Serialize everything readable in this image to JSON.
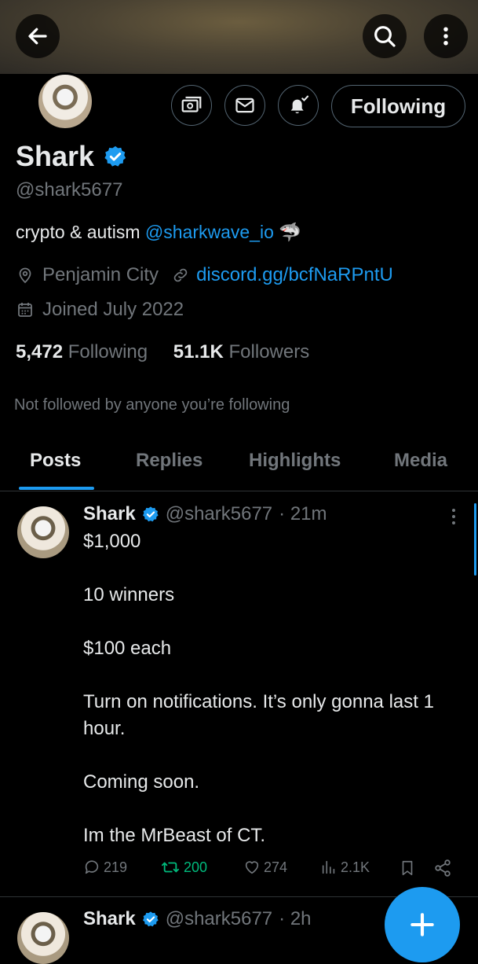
{
  "header": {
    "back_icon": "arrow-left-icon",
    "search_icon": "search-icon",
    "more_icon": "more-vertical-icon"
  },
  "profile": {
    "name": "Shark",
    "handle": "@shark5677",
    "bio_text": "crypto & autism ",
    "bio_mention": "@sharkwave_io",
    "bio_emoji": "🦈",
    "location": "Penjamin City",
    "website": "discord.gg/bcfNaRPntU",
    "joined": "Joined July 2022",
    "following_count": "5,472",
    "following_label": "Following",
    "followers_count": "51.1K",
    "followers_label": "Followers",
    "not_followed": "Not followed by anyone you’re following"
  },
  "action_buttons": {
    "follow_state": "Following"
  },
  "tabs": [
    {
      "label": "Posts"
    },
    {
      "label": "Replies"
    },
    {
      "label": "Highlights"
    },
    {
      "label": "Media"
    }
  ],
  "posts": [
    {
      "name": "Shark",
      "handle": "@shark5677",
      "time": "· 21m",
      "lines": [
        "$1,000",
        "10 winners",
        "$100 each",
        "Turn on notifications. It’s only gonna last 1 hour.",
        "Coming soon.",
        "Im the MrBeast of CT."
      ],
      "stats": {
        "replies": "219",
        "reposts": "200",
        "likes": "274",
        "views": "2.1K"
      }
    },
    {
      "name": "Shark",
      "handle": "@shark5677",
      "time": "· 2h"
    }
  ],
  "colors": {
    "accent": "#1d9bf0",
    "repost_active": "#00ba7c",
    "muted": "#71767b",
    "border": "#2f3336"
  }
}
